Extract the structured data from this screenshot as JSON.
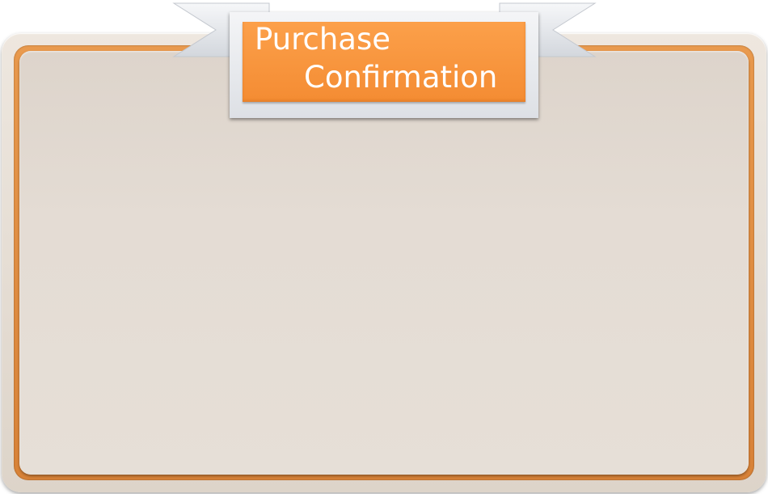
{
  "dialog": {
    "title_line1": "Purchase",
    "title_line2": "Confirmation"
  },
  "colors": {
    "accent_orange": "#f7943c",
    "frame_orange": "#e08b40",
    "panel_beige": "#e4dcd4",
    "ribbon_silver": "#dfe3e8",
    "title_text": "#ffffff"
  }
}
